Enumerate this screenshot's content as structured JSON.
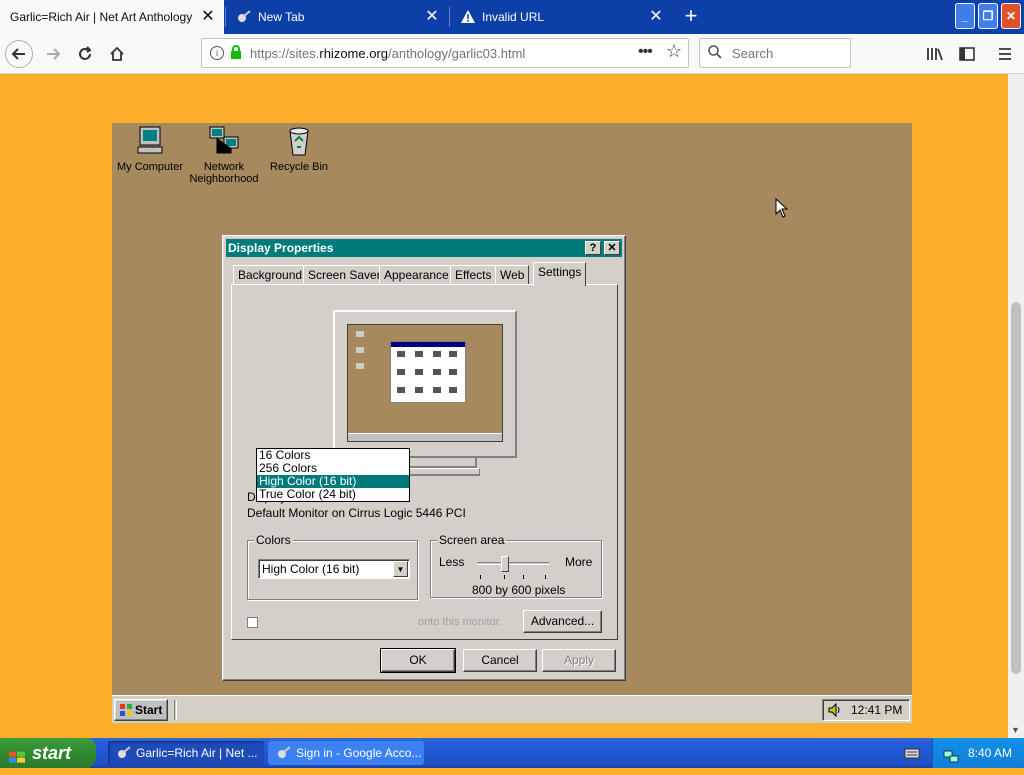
{
  "browser": {
    "tabs": [
      {
        "title": "Garlic=Rich Air | Net Art Anthology",
        "active": true
      },
      {
        "title": "New Tab",
        "active": false
      },
      {
        "title": "Invalid URL",
        "active": false
      }
    ],
    "url_prefix": "https://sites.",
    "url_domain": "rhizome.org",
    "url_path": "/anthology/garlic03.html",
    "search_placeholder": "Search"
  },
  "desktop": {
    "icons": [
      {
        "label": "My Computer"
      },
      {
        "label": "Network Neighborhood"
      },
      {
        "label": "Recycle Bin"
      }
    ]
  },
  "dialog": {
    "title": "Display Properties",
    "help_label": "?",
    "close_label": "✕",
    "tabs": [
      "Background",
      "Screen Saver",
      "Appearance",
      "Effects",
      "Web",
      "Settings"
    ],
    "selected_tab": "Settings",
    "display_label": "Display:",
    "display_value": "Default Monitor on Cirrus Logic 5446 PCI",
    "colors": {
      "group_label": "Colors",
      "selected": "High Color (16 bit)",
      "options": [
        "16 Colors",
        "256 Colors",
        "High Color (16 bit)",
        "True Color (24 bit)"
      ],
      "highlighted_index": 2
    },
    "screen_area": {
      "group_label": "Screen area",
      "less_label": "Less",
      "more_label": "More",
      "value_text": "800 by 600 pixels"
    },
    "hidden_checkbox_text": "onto this monitor.",
    "advanced_label": "Advanced...",
    "ok_label": "OK",
    "cancel_label": "Cancel",
    "apply_label": "Apply"
  },
  "win98_taskbar": {
    "start_label": "Start",
    "clock": "12:41 PM"
  },
  "xp_taskbar": {
    "start_label": "start",
    "items": [
      {
        "label": "Garlic=Rich Air | Net ..."
      },
      {
        "label": "Sign in - Google Acco..."
      }
    ],
    "clock": "8:40 AM"
  },
  "colors": {
    "page_bg": "#fbaf2b",
    "desktop_bg": "#a68a5e",
    "win98_title": "#007b7b",
    "xp_blue": "#245edb"
  }
}
